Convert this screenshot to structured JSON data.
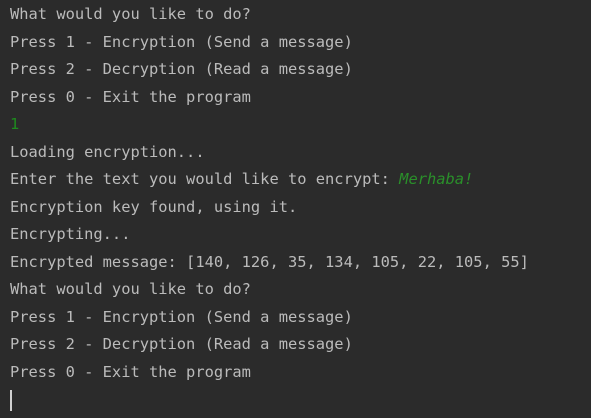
{
  "colors": {
    "background": "#2b2b2b",
    "output_text": "#bbbbbb",
    "user_input": "#2a8f2a",
    "cursor": "#d0d0d0"
  },
  "console": {
    "lines": [
      "What would you like to do?",
      "Press 1 - Encryption (Send a message)",
      "Press 2 - Decryption (Read a message)",
      "Press 0 - Exit the program",
      "1",
      "Loading encryption...",
      "Enter the text you would like to encrypt: ",
      "Encryption key found, using it.",
      "Encrypting...",
      "Encrypted message: [140, 126, 35, 134, 105, 22, 105, 55]",
      "What would you like to do?",
      "Press 1 - Encryption (Send a message)",
      "Press 2 - Decryption (Read a message)",
      "Press 0 - Exit the program"
    ],
    "encrypt_input": "Merhaba!"
  }
}
